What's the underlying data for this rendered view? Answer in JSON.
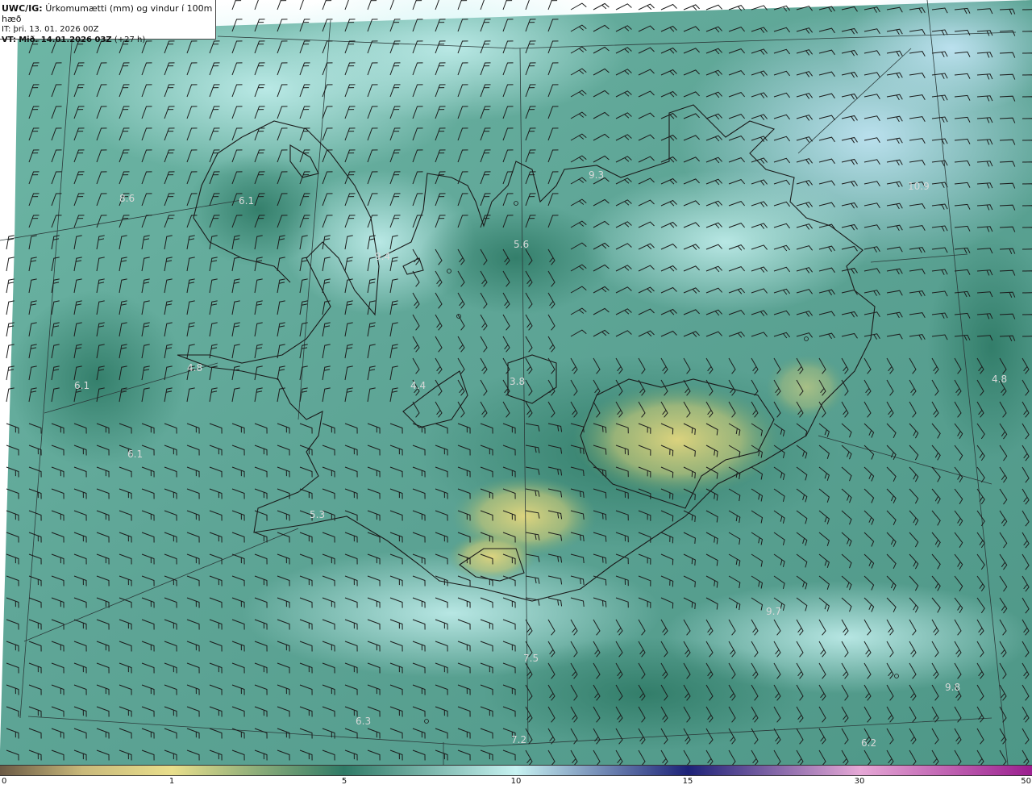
{
  "header": {
    "model": "UWC/IG:",
    "description": "Úrkomumætti (mm) og vindur í 100m hæð",
    "initial_time": "IT: þri. 13. 01. 2026 00Z",
    "valid_prefix": "VT:",
    "valid_time": "Mið. 14.01.2026 03Z",
    "lead": "(+27 h)"
  },
  "colors": {
    "land_outline": "#1a1a1a",
    "grid_line": "#2b3a3a",
    "label_text": "#d9d9d9",
    "title_bg": "#ffffff",
    "low_precip": "#e4d77e",
    "mid_precip": "#3e8a79",
    "high_precip": "#c9f1f0"
  },
  "colorbar": {
    "ticks": [
      "0",
      "1",
      "5",
      "10",
      "15",
      "30",
      "50"
    ],
    "stops": [
      {
        "value": "0",
        "color": "#6b5a45"
      },
      {
        "value": "1",
        "color": "#e9df8c"
      },
      {
        "value": "5",
        "color": "#2f7a66"
      },
      {
        "value": "10",
        "color": "#c8f3f2"
      },
      {
        "value": "15",
        "color": "#1d2278"
      },
      {
        "value": "30",
        "color": "#e6a8d6"
      },
      {
        "value": "50",
        "color": "#9b1f8f"
      }
    ]
  },
  "value_labels": [
    "6.1",
    "9.4",
    "5.6",
    "9.3",
    "10.9",
    "4.8",
    "6.1",
    "6.1",
    "4.4",
    "3.8",
    "4.8",
    "5.3",
    "9.7",
    "7.5",
    "9.8",
    "6.3",
    "7.2",
    "6.2",
    "8.6"
  ],
  "wind": {
    "direction": "wind barbs at 100 m",
    "features": [
      "icons: wind-barb-icon"
    ]
  }
}
